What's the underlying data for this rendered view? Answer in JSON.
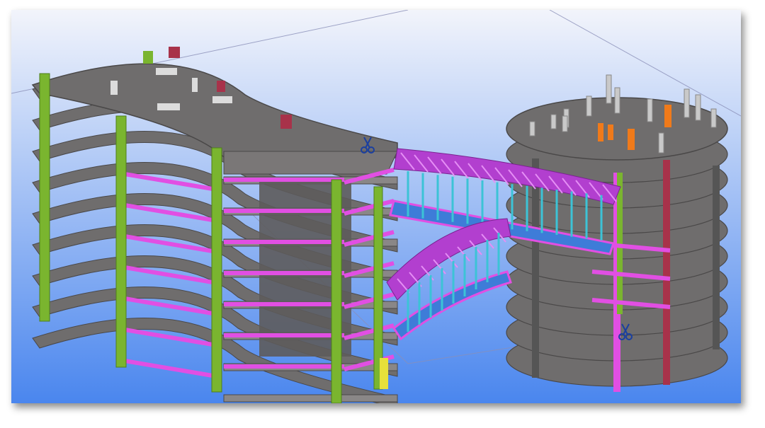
{
  "viewport": {
    "background_top": "#f2f4fb",
    "background_bottom": "#4a86ee"
  },
  "colors": {
    "slab": "#6f6d6d",
    "slab_edge": "#4a4848",
    "column_green": "#7ab52f",
    "beam_magenta": "#e14fe3",
    "hanger_cyan": "#3cc3d6",
    "truss_purple": "#b23fcf",
    "core_red": "#a8324a",
    "orange_stub": "#f07a1a",
    "yellow_post": "#e6e03a"
  },
  "models": [
    {
      "name": "curved-office-block"
    },
    {
      "name": "circular-tower"
    },
    {
      "name": "upper-skybridge"
    },
    {
      "name": "lower-skybridge"
    }
  ],
  "markers": [
    {
      "name": "clip-plane-symbol-bridge-icon"
    },
    {
      "name": "clip-plane-symbol-tower-icon"
    }
  ]
}
